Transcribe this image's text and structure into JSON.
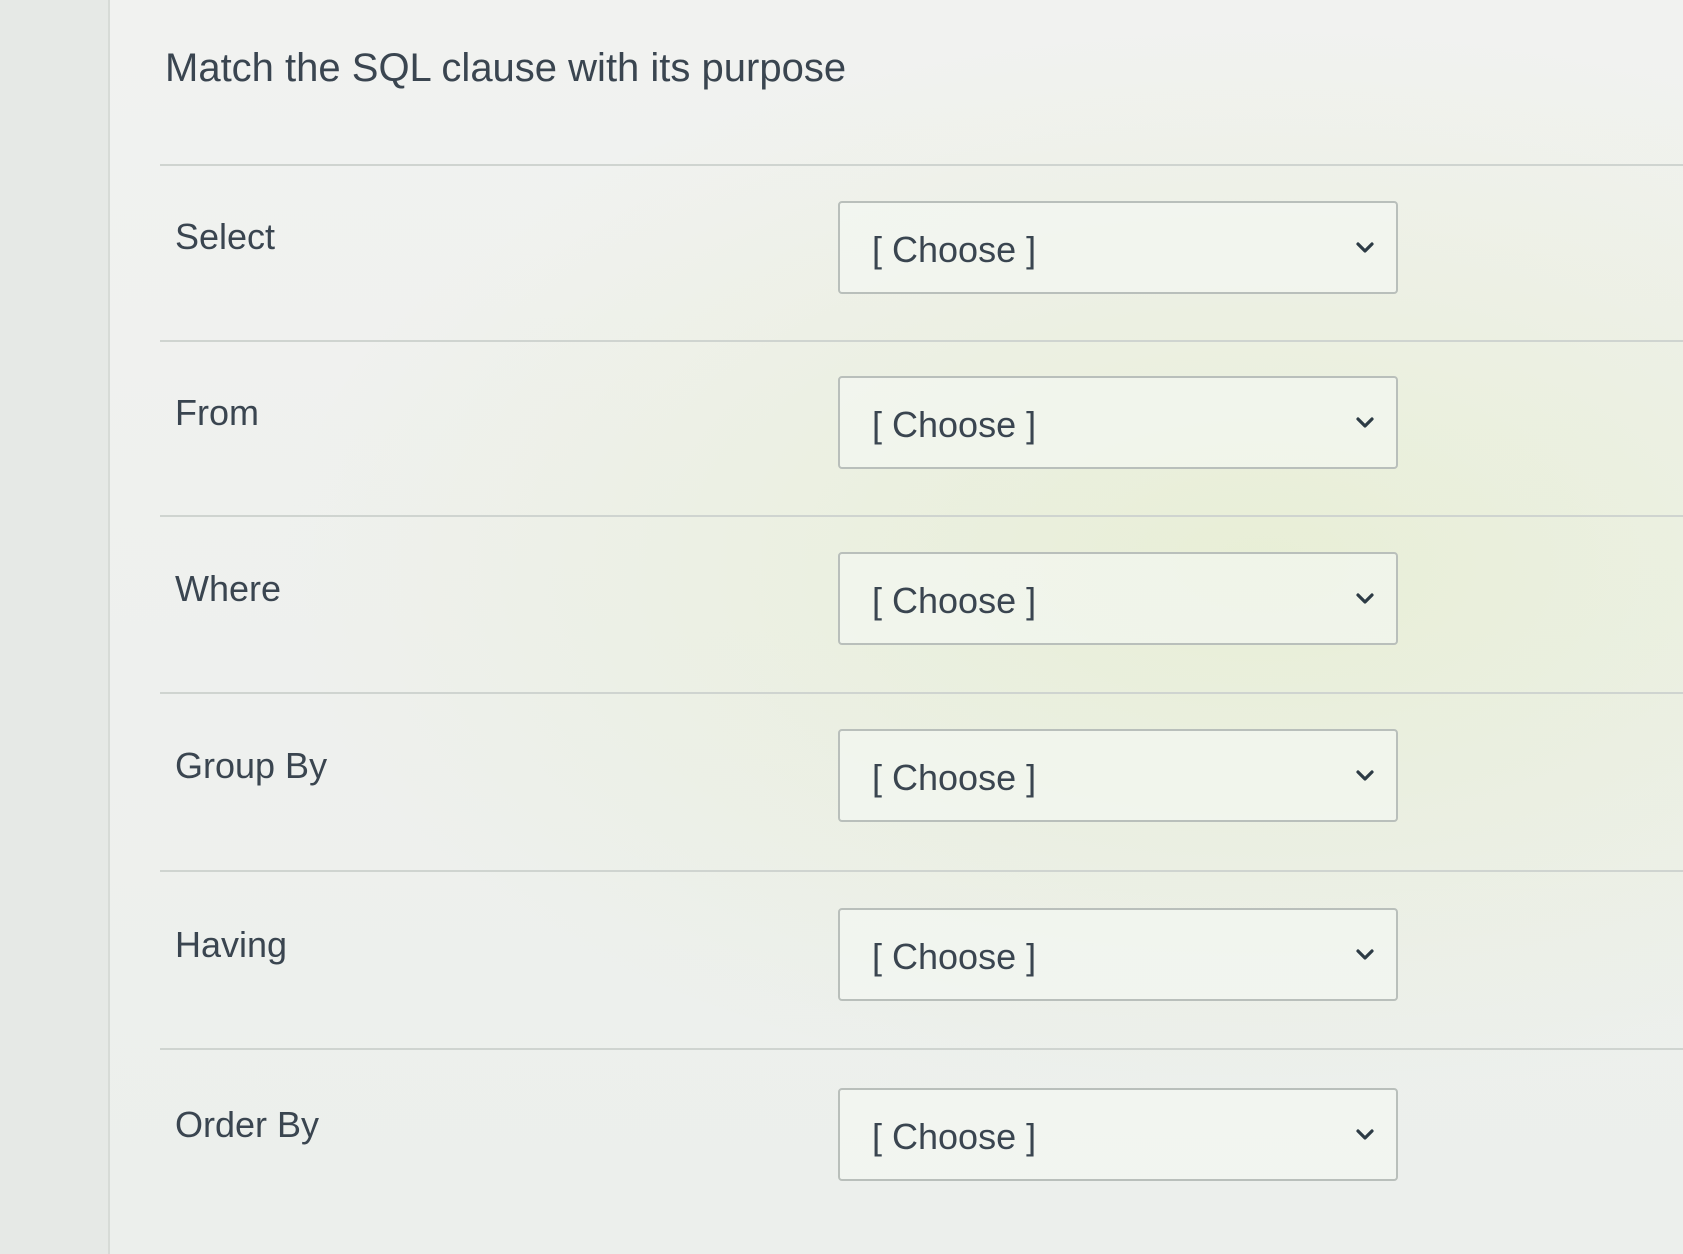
{
  "question": {
    "title": "Match the SQL clause with its purpose"
  },
  "rows": [
    {
      "label": "Select",
      "selected": "[ Choose ]"
    },
    {
      "label": "From",
      "selected": "[ Choose ]"
    },
    {
      "label": "Where",
      "selected": "[ Choose ]"
    },
    {
      "label": "Group By",
      "selected": "[ Choose ]"
    },
    {
      "label": "Having",
      "selected": "[ Choose ]"
    },
    {
      "label": "Order By",
      "selected": "[ Choose ]"
    }
  ],
  "icons": {
    "dropdown": "chevron-down-icon"
  }
}
